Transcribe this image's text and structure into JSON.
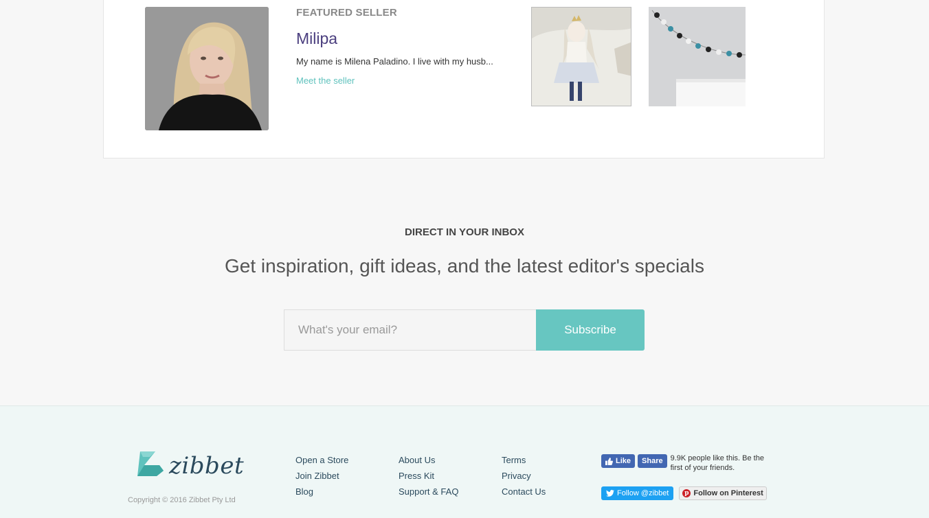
{
  "featured": {
    "label": "FEATURED SELLER",
    "seller_name": "Milipa",
    "description": "My name is Milena Paladino. I live with my husb...",
    "meet_link": "Meet the seller"
  },
  "newsletter": {
    "eyebrow": "DIRECT IN YOUR INBOX",
    "headline": "Get inspiration, gift ideas, and the latest editor's specials",
    "email_placeholder": "What's your email?",
    "subscribe_label": "Subscribe"
  },
  "footer": {
    "logo_text": "zibbet",
    "copyright": "Copyright © 2016 Zibbet Pty Ltd",
    "col1": [
      "Open a Store",
      "Join Zibbet",
      "Blog"
    ],
    "col2": [
      "About Us",
      "Press Kit",
      "Support & FAQ"
    ],
    "col3": [
      "Terms",
      "Privacy",
      "Contact Us"
    ],
    "social": {
      "fb_like": "Like",
      "fb_share": "Share",
      "fb_text": "9.9K people like this. Be the first of your friends.",
      "twitter": "Follow @zibbet",
      "pinterest": "Follow on Pinterest"
    }
  },
  "colors": {
    "accent_teal": "#67c6c1",
    "seller_name_purple": "#4b3f7f",
    "footer_navy": "#2b4a5d",
    "facebook": "#4267b2",
    "twitter": "#1da1f2",
    "pinterest": "#cb2027"
  },
  "icons": [
    "seller-photo",
    "doll-product-image",
    "garland-product-image",
    "zibbet-swan-logo-icon",
    "thumbs-up-icon",
    "twitter-bird-icon",
    "pinterest-icon"
  ]
}
